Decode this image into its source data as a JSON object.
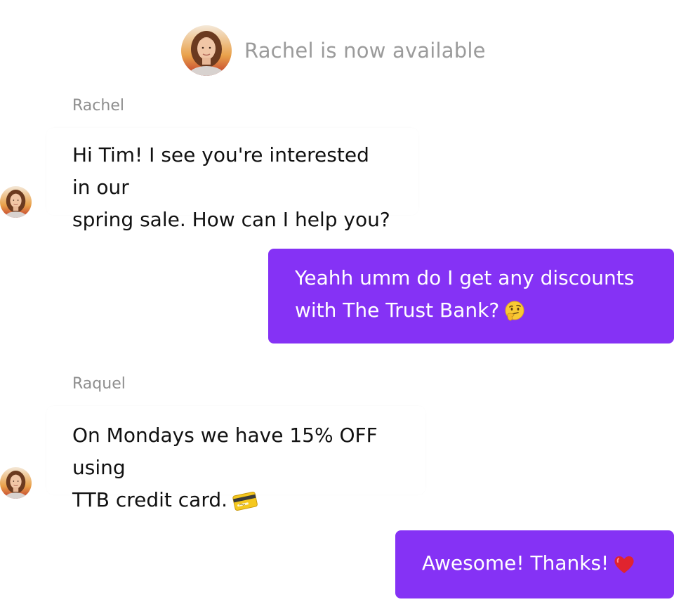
{
  "status": {
    "text": "Rachel is now available"
  },
  "messages": [
    {
      "sender": "Rachel",
      "line1": "Hi Tim! I see you're interested in our",
      "line2": "spring sale. How can I help you?"
    },
    {
      "line1": "Yeahh umm do I get any discounts",
      "line2": "with The Trust Bank?",
      "emoji": "thinking-face-icon"
    },
    {
      "sender": "Raquel",
      "line1": "On Mondays we have 15% OFF using",
      "line2": "TTB credit card.",
      "emoji": "credit-card-icon"
    },
    {
      "line1": "Awesome! Thanks!",
      "emoji": "red-heart-icon"
    }
  ],
  "colors": {
    "outgoing_bubble": "#8532f5",
    "status_text": "#9b9b9b",
    "sender_label": "#8e8e8e"
  }
}
